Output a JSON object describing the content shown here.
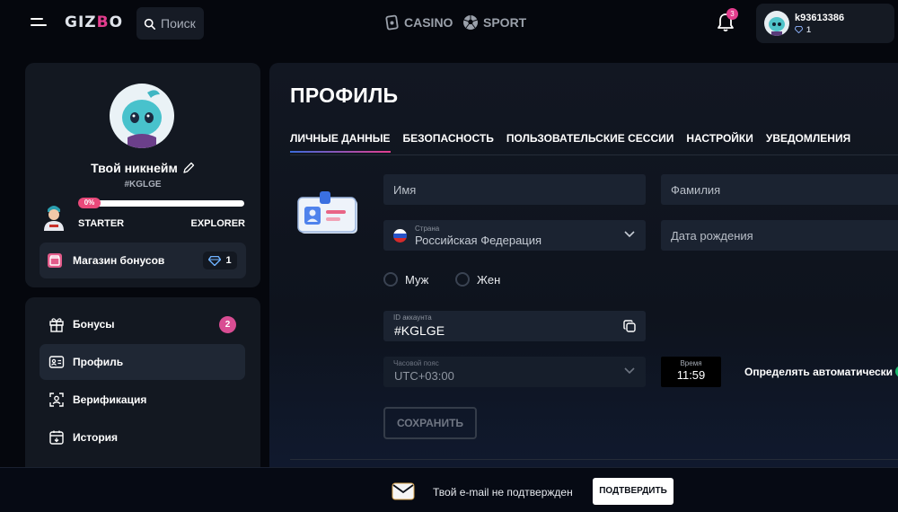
{
  "header": {
    "logo_main": "GIZ",
    "logo_accent": "B",
    "logo_tail": "O",
    "search_placeholder": "Поиск",
    "nav": [
      {
        "label": "CASINO",
        "icon": "casino-icon"
      },
      {
        "label": "SPORT",
        "icon": "soccer-ball-icon"
      }
    ],
    "notifications_count": "3",
    "user": {
      "name": "k93613386",
      "gems": "1"
    }
  },
  "profile_card": {
    "nickname": "Твой никнейм",
    "id": "#KGLGE",
    "progress_label": "0%",
    "progress_fraction": 0,
    "level_start": "STARTER",
    "level_end": "EXPLORER",
    "shop_label": "Магазин бонусов",
    "shop_gems": "1"
  },
  "menu": {
    "items": [
      {
        "label": "Бонусы",
        "badge": "2",
        "icon": "gift-icon"
      },
      {
        "label": "Профиль",
        "icon": "id-card-icon"
      },
      {
        "label": "Верификация",
        "icon": "face-scan-icon"
      },
      {
        "label": "История",
        "icon": "history-icon"
      }
    ]
  },
  "main": {
    "title": "ПРОФИЛЬ",
    "tabs": [
      {
        "label": "ЛИЧНЫЕ ДАННЫЕ",
        "active": true
      },
      {
        "label": "БЕЗОПАСНОСТЬ"
      },
      {
        "label": "ПОЛЬЗОВАТЕЛЬСКИЕ СЕССИИ"
      },
      {
        "label": "НАСТРОЙКИ"
      },
      {
        "label": "УВЕДОМЛЕНИЯ"
      }
    ],
    "form": {
      "first_name_placeholder": "Имя",
      "last_name_placeholder": "Фамилия",
      "country_label": "Страна",
      "country_value": "Российская Федерация",
      "birth_placeholder": "Дата рождения",
      "gender_male": "Муж",
      "gender_female": "Жен",
      "account_id_label": "ID аккаунта",
      "account_id_value": "#KGLGE",
      "timezone_label": "Часовой пояс",
      "timezone_value": "UTC+03:00",
      "time_label": "Время",
      "time_value": "11:59",
      "auto_detect_label": "Определять автоматически",
      "save_label": "СОХРАНИТЬ"
    }
  },
  "banner": {
    "text": "Твой e-mail не подтвержден",
    "button": "ПОДТВЕРДИТЬ"
  },
  "colors": {
    "accent_pink": "#e33d8e",
    "toggle_green": "#1bb86a",
    "background": "#05070d"
  }
}
